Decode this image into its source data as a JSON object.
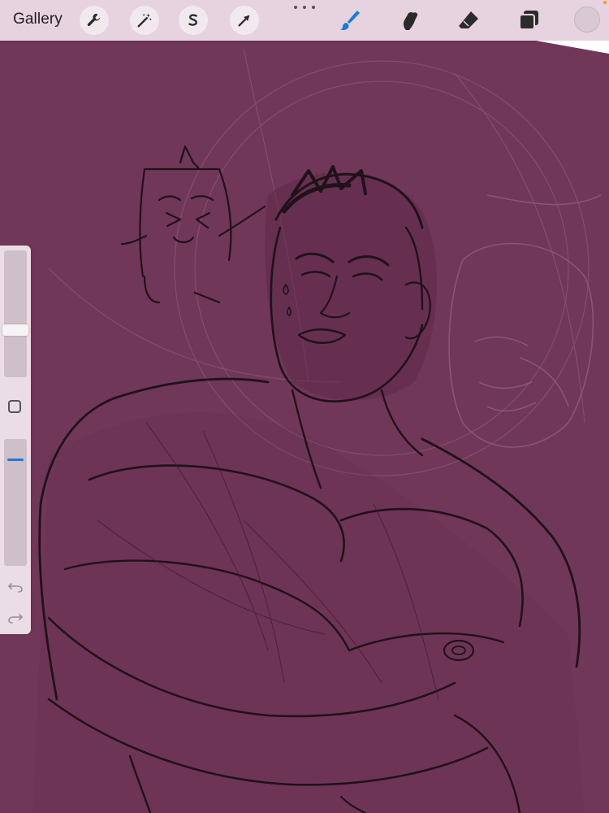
{
  "toolbar": {
    "gallery_label": "Gallery",
    "left_tools": [
      {
        "name": "actions",
        "icon": "wrench-icon"
      },
      {
        "name": "adjustments",
        "icon": "magic-wand-icon"
      },
      {
        "name": "selection",
        "icon": "selection-s-icon"
      },
      {
        "name": "transform",
        "icon": "arrow-cursor-icon"
      }
    ],
    "right_tools": [
      {
        "name": "brush",
        "icon": "brush-icon",
        "active": true
      },
      {
        "name": "smudge",
        "icon": "smudge-finger-icon",
        "active": false
      },
      {
        "name": "eraser",
        "icon": "eraser-icon",
        "active": false
      },
      {
        "name": "layers",
        "icon": "layers-icon",
        "active": false
      }
    ],
    "colors": {
      "toolbar_bg": "#e6d3df",
      "active_tool": "#1a7bd8",
      "current_color": "#d9c9d3"
    }
  },
  "sidebar": {
    "brush_size_level": 0.37,
    "brush_opacity_level": 0.16,
    "modify_icon": "square-icon",
    "undo_icon": "undo-arrow-icon",
    "redo_icon": "redo-arrow-icon"
  },
  "canvas": {
    "background_color": "#713758",
    "line_color": "#1f1218"
  }
}
